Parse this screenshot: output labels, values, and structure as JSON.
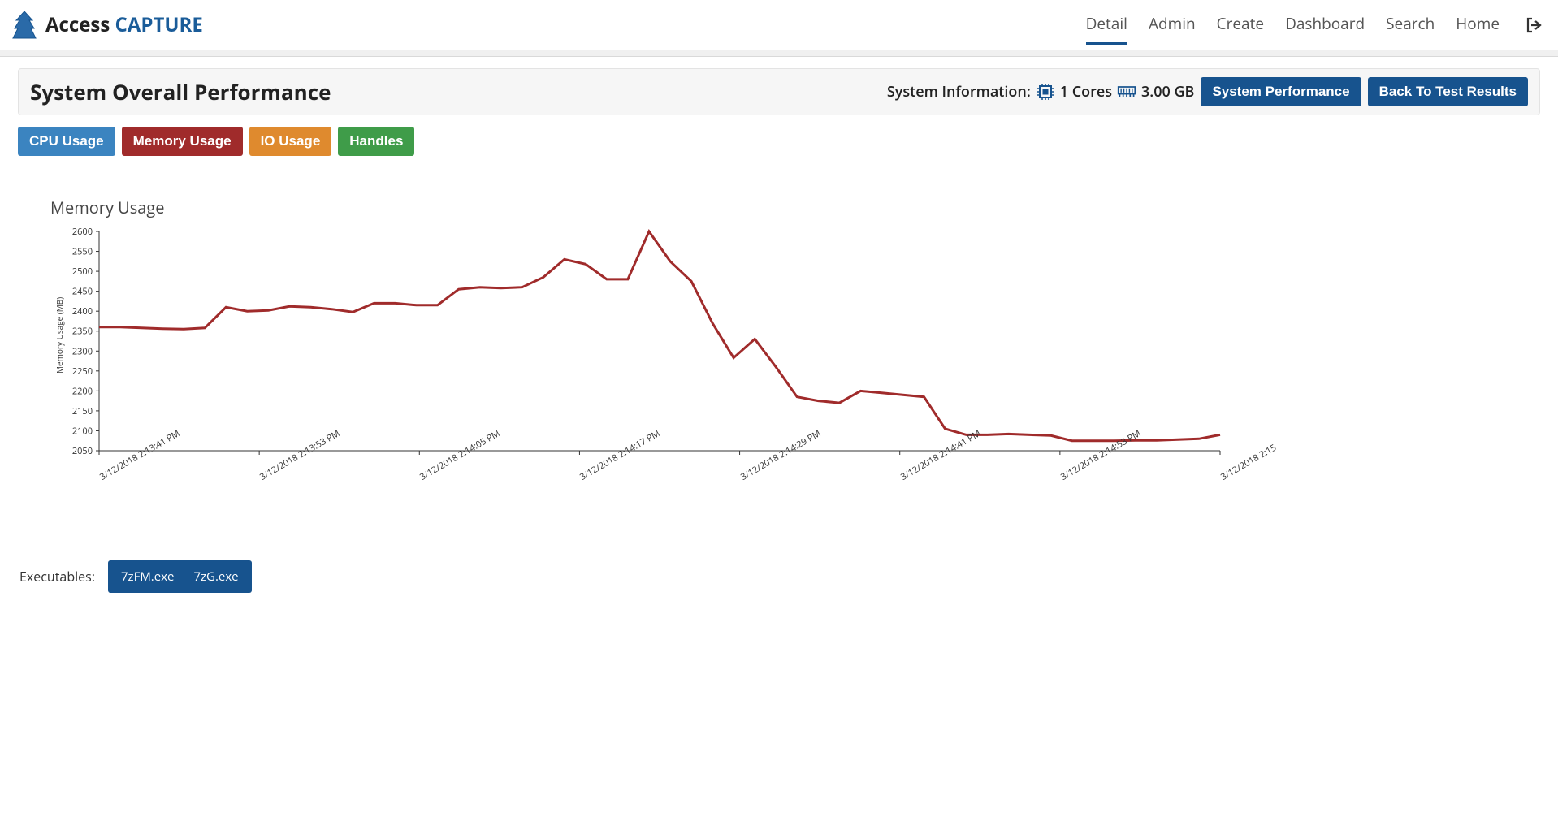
{
  "brand": {
    "part1": "Access ",
    "part2": "CAPTURE"
  },
  "nav": {
    "items": [
      {
        "label": "Detail",
        "active": true
      },
      {
        "label": "Admin",
        "active": false
      },
      {
        "label": "Create",
        "active": false
      },
      {
        "label": "Dashboard",
        "active": false
      },
      {
        "label": "Search",
        "active": false
      },
      {
        "label": "Home",
        "active": false
      }
    ]
  },
  "panel": {
    "title": "System Overall Performance",
    "sysinfo_label": "System Information:",
    "cores": "1 Cores",
    "memory": "3.00 GB",
    "btn_sysperf": "System Performance",
    "btn_back": "Back To Test Results"
  },
  "tabs": {
    "cpu": "CPU Usage",
    "memory": "Memory Usage",
    "io": "IO Usage",
    "handles": "Handles"
  },
  "chart_title": "Memory Usage",
  "chart_data": {
    "type": "line",
    "title": "Memory Usage",
    "ylabel": "Memory Usage (MB)",
    "xlabel": "",
    "ylim": [
      2050,
      2600
    ],
    "y_ticks": [
      2050,
      2100,
      2150,
      2200,
      2250,
      2300,
      2350,
      2400,
      2450,
      2500,
      2550,
      2600
    ],
    "x_tick_labels": [
      "3/12/2018 2:13:41 PM",
      "3/12/2018 2:13:53 PM",
      "3/12/2018 2:14:05 PM",
      "3/12/2018 2:14:17 PM",
      "3/12/2018 2:14:29 PM",
      "3/12/2018 2:14:41 PM",
      "3/12/2018 2:14:53 PM",
      "3/12/2018 2:15"
    ],
    "series": [
      {
        "name": "Memory Usage (MB)",
        "color": "#a02b2b",
        "values": [
          2360,
          2360,
          2358,
          2356,
          2355,
          2358,
          2410,
          2400,
          2402,
          2412,
          2410,
          2405,
          2398,
          2420,
          2420,
          2415,
          2415,
          2455,
          2460,
          2458,
          2460,
          2485,
          2530,
          2518,
          2480,
          2480,
          2600,
          2525,
          2475,
          2370,
          2283,
          2330,
          2260,
          2185,
          2175,
          2170,
          2200,
          2195,
          2190,
          2185,
          2105,
          2090,
          2090,
          2092,
          2090,
          2088,
          2075,
          2075,
          2075,
          2076,
          2076,
          2078,
          2080,
          2090
        ]
      }
    ]
  },
  "executables": {
    "label": "Executables:",
    "items": [
      "7zFM.exe",
      "7zG.exe"
    ]
  }
}
